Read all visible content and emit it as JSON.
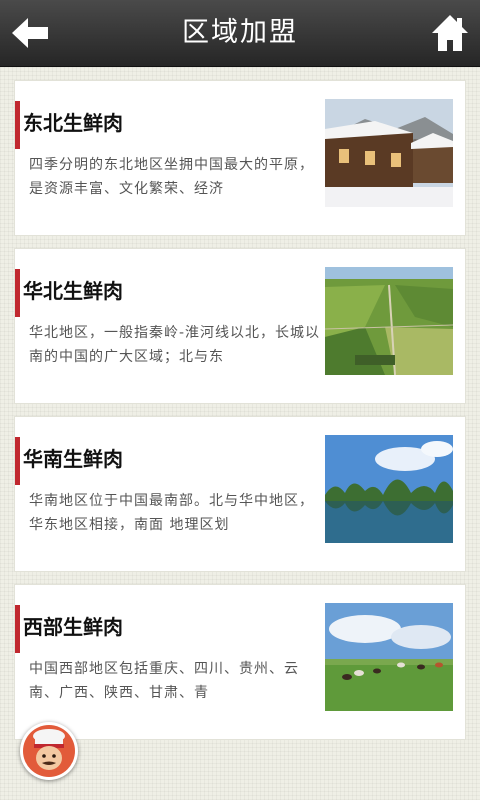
{
  "header": {
    "title": "区域加盟",
    "back_icon": "arrow-left-icon",
    "home_icon": "home-icon"
  },
  "regions": [
    {
      "title": "东北生鲜肉",
      "desc": "四季分明的东北地区坐拥中国最大的平原，是资源丰富、文化繁荣、经济",
      "image": "snowy-village-photo"
    },
    {
      "title": "华北生鲜肉",
      "desc": "华北地区，一般指秦岭-淮河线以北，长城以南的中国的广大区域；北与东",
      "image": "farmland-aerial-photo"
    },
    {
      "title": "华南生鲜肉",
      "desc": "华南地区位于中国最南部。北与华中地区，华东地区相接，南面 地理区划",
      "image": "karst-river-photo"
    },
    {
      "title": "西部生鲜肉",
      "desc": "中国西部地区包括重庆、四川、贵州、云南、广西、陕西、甘肃、青",
      "image": "grassland-cattle-photo"
    }
  ],
  "colors": {
    "accent": "#c0282f",
    "header": "#2e2e2e"
  },
  "fab": {
    "icon": "chef-avatar-icon"
  }
}
